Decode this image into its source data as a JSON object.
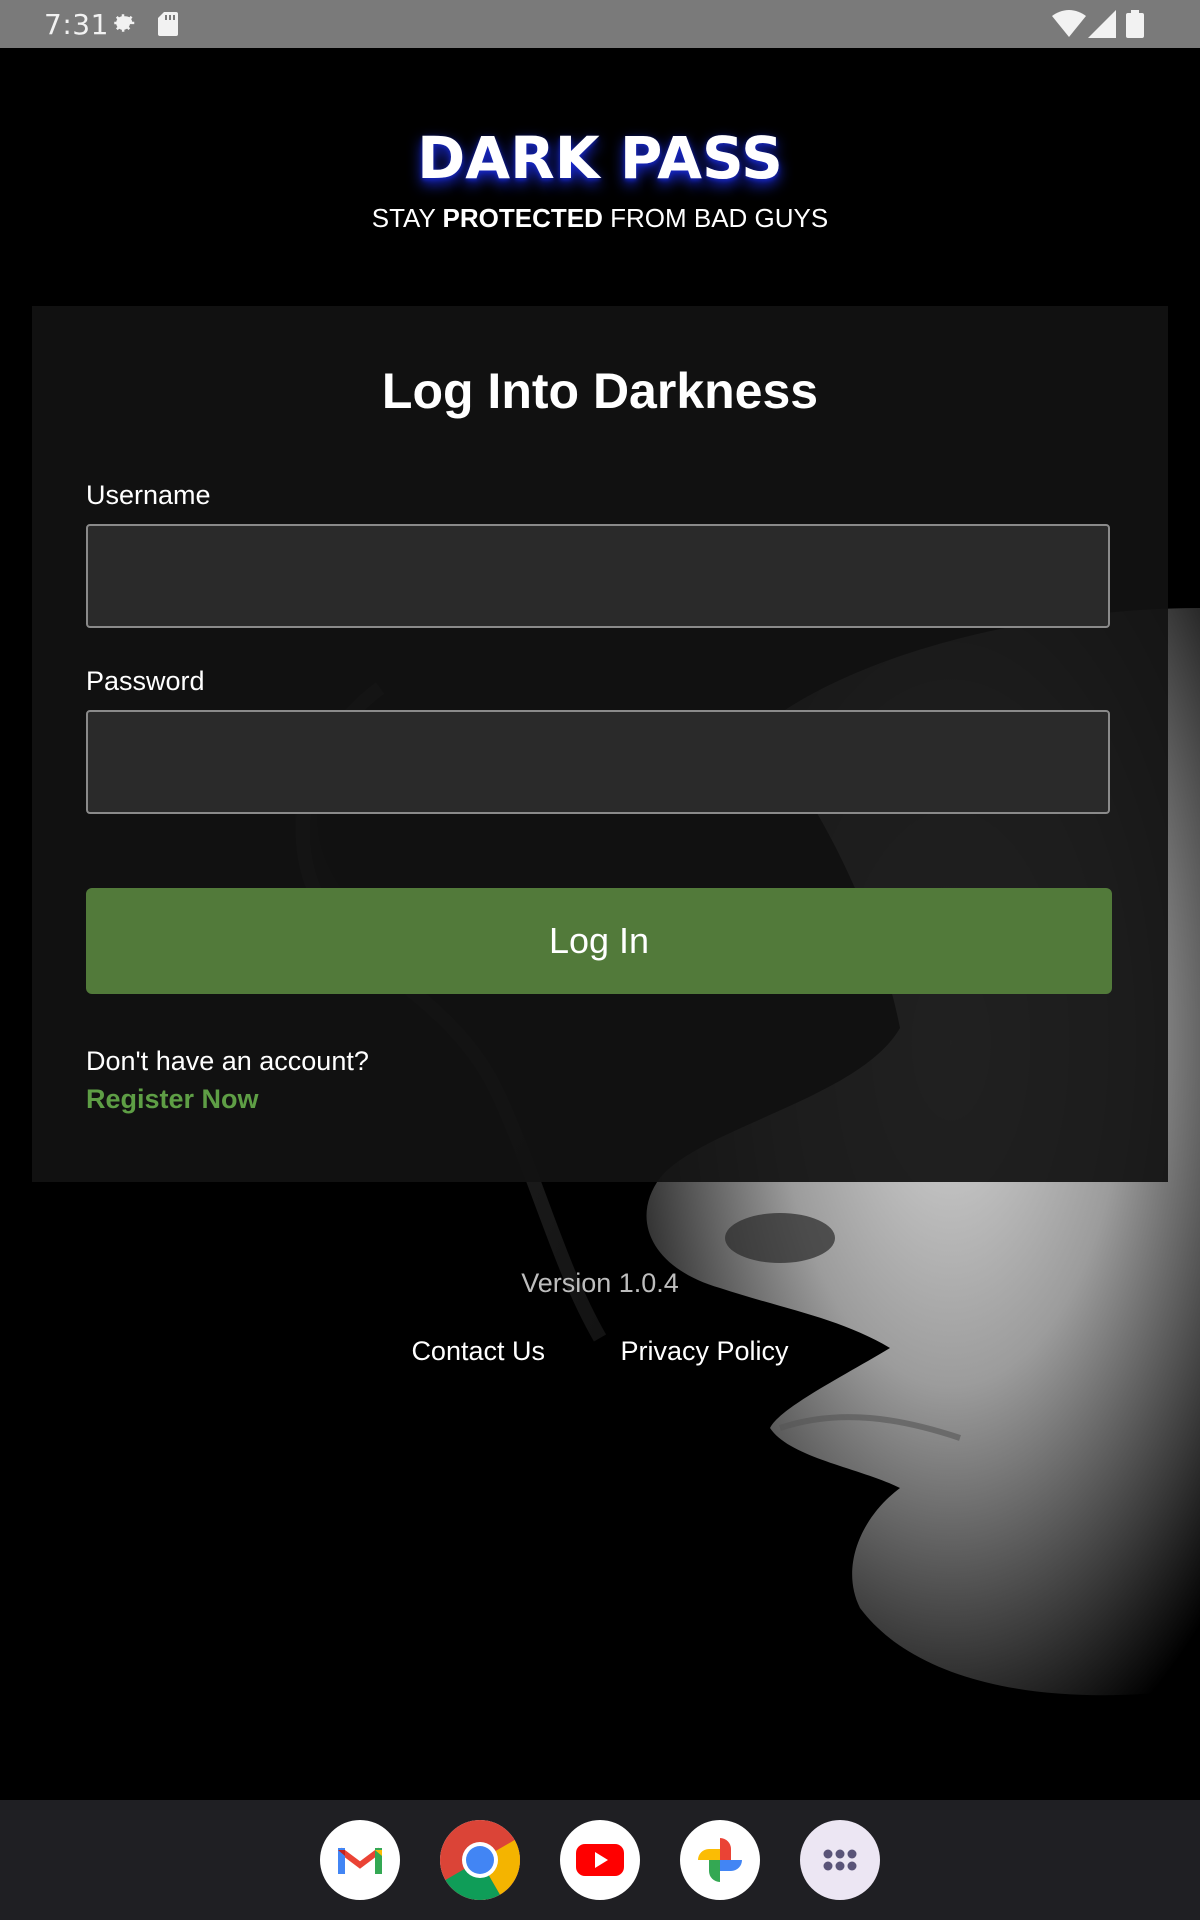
{
  "status_bar": {
    "time": "7:31",
    "icons": [
      "settings-gear-icon",
      "sd-card-icon",
      "wifi-icon",
      "cell-signal-icon",
      "battery-icon"
    ]
  },
  "brand": {
    "title": "DARK PASS",
    "tagline_prefix": "STAY ",
    "tagline_bold": "PROTECTED",
    "tagline_suffix": " FROM BAD GUYS",
    "title_glow_color": "#1a2bd8"
  },
  "login_card": {
    "title": "Log Into Darkness",
    "username_label": "Username",
    "username_value": "",
    "password_label": "Password",
    "password_value": "",
    "login_button_label": "Log In",
    "login_button_color": "#527a3a",
    "no_account_text": "Don't have an account?",
    "register_link": "Register Now",
    "register_link_color": "#5e9e45"
  },
  "footer": {
    "version": "Version 1.0.4",
    "links": [
      "Contact Us",
      "Privacy Policy"
    ]
  },
  "dock": {
    "apps": [
      {
        "name": "Gmail",
        "icon": "gmail-icon"
      },
      {
        "name": "Chrome",
        "icon": "chrome-icon"
      },
      {
        "name": "YouTube",
        "icon": "youtube-icon"
      },
      {
        "name": "Photos",
        "icon": "photos-icon"
      },
      {
        "name": "App drawer",
        "icon": "app-drawer-icon"
      }
    ]
  }
}
